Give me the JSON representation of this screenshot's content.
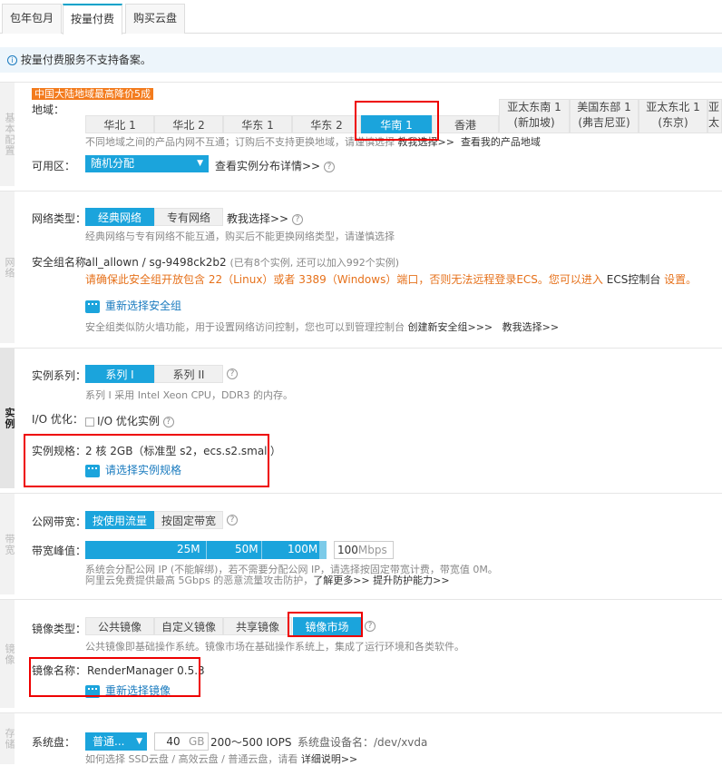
{
  "tabs": [
    "包年包月",
    "按量付费",
    "购买云盘"
  ],
  "notice": "按量付费服务不支持备案。",
  "sections": {
    "basic": "基本配置",
    "network": "网络",
    "instance": "实例",
    "bandwidth": "带宽",
    "image": "镜像",
    "storage": "存储"
  },
  "region": {
    "promo": "中国大陆地域最高降价5成",
    "label": "地域：",
    "items": [
      "华北 1",
      "华北 2",
      "华东 1",
      "华东 2",
      "华南 1",
      "香港"
    ],
    "overseas": [
      {
        "name": "亚太东南 1",
        "sub": "(新加坡)"
      },
      {
        "name": "美国东部 1",
        "sub": "(弗吉尼亚)"
      },
      {
        "name": "亚太东北 1",
        "sub": "(东京)"
      },
      {
        "name": "亚太"
      }
    ],
    "desc": "不同地域之间的产品内网不互通；订购后不支持更换地域，请谨慎选择",
    "help": "教我选择>>",
    "myregion": "查看我的产品地域"
  },
  "zone": {
    "label": "可用区：",
    "value": "随机分配",
    "link": "查看实例分布详情>>"
  },
  "network": {
    "label": "网络类型：",
    "options": [
      "经典网络",
      "专有网络"
    ],
    "help": "教我选择>>",
    "desc": "经典网络与专有网络不能互通，购买后不能更换网络类型，请谨慎选择",
    "sg_label": "安全组名称：",
    "sg_value": "all_allown / sg-9498ck2b2",
    "sg_info": "(已有8个实例, 还可以加入992个实例)",
    "warning": "请确保此安全组开放包含 22（Linux）或者 3389（Windows）端口，否则无法远程登录ECS。您可以进入",
    "console": "ECS控制台",
    "setting": "设置。",
    "reselect": "重新选择安全组",
    "sg_desc": "安全组类似防火墙功能，用于设置网络访问控制，您也可以到管理控制台",
    "create": "创建新安全组>>>",
    "help2": "教我选择>>"
  },
  "instance": {
    "series_label": "实例系列：",
    "series": [
      "系列 I",
      "系列 II"
    ],
    "series_desc": "系列 I 采用 Intel Xeon CPU，DDR3 的内存。",
    "io_label": "I/O 优化：",
    "io_value": "I/O 优化实例",
    "spec_label": "实例规格：",
    "spec_value": "2 核 2GB（标准型 s2，ecs.s2.small）",
    "spec_select": "请选择实例规格"
  },
  "bandwidth": {
    "label": "公网带宽：",
    "options": [
      "按使用流量",
      "按固定带宽"
    ],
    "peak_label": "带宽峰值：",
    "marks": [
      "25M",
      "50M",
      "100M"
    ],
    "value": "100",
    "unit": "Mbps",
    "desc1": "系统会分配公网 IP (不能解绑)，若不需要分配公网 IP，请选择按固定带宽计费，带宽值 0M。",
    "desc2": "阿里云免费提供最高 5Gbps 的恶意流量攻击防护，",
    "more": "了解更多>>",
    "upgrade": "提升防护能力>>"
  },
  "image": {
    "type_label": "镜像类型：",
    "types": [
      "公共镜像",
      "自定义镜像",
      "共享镜像",
      "镜像市场"
    ],
    "desc": "公共镜像即基础操作系统。镜像市场在基础操作系统上，集成了运行环境和各类软件。",
    "name_label": "镜像名称：",
    "name_value": "RenderManager 0.5.3",
    "reselect": "重新选择镜像"
  },
  "storage": {
    "label": "系统盘：",
    "type": "普通...",
    "size": "40",
    "unit": "GB",
    "iops": "200～500 IOPS",
    "device_label": "系统盘设备名：/dev/xvda",
    "desc": "如何选择 SSD云盘 / 高效云盘 / 普通云盘，请看",
    "detail": "详细说明>>"
  },
  "colors": {
    "accent": "#1ba4dc",
    "warning": "#e6711b",
    "highlight": "#e00000"
  }
}
